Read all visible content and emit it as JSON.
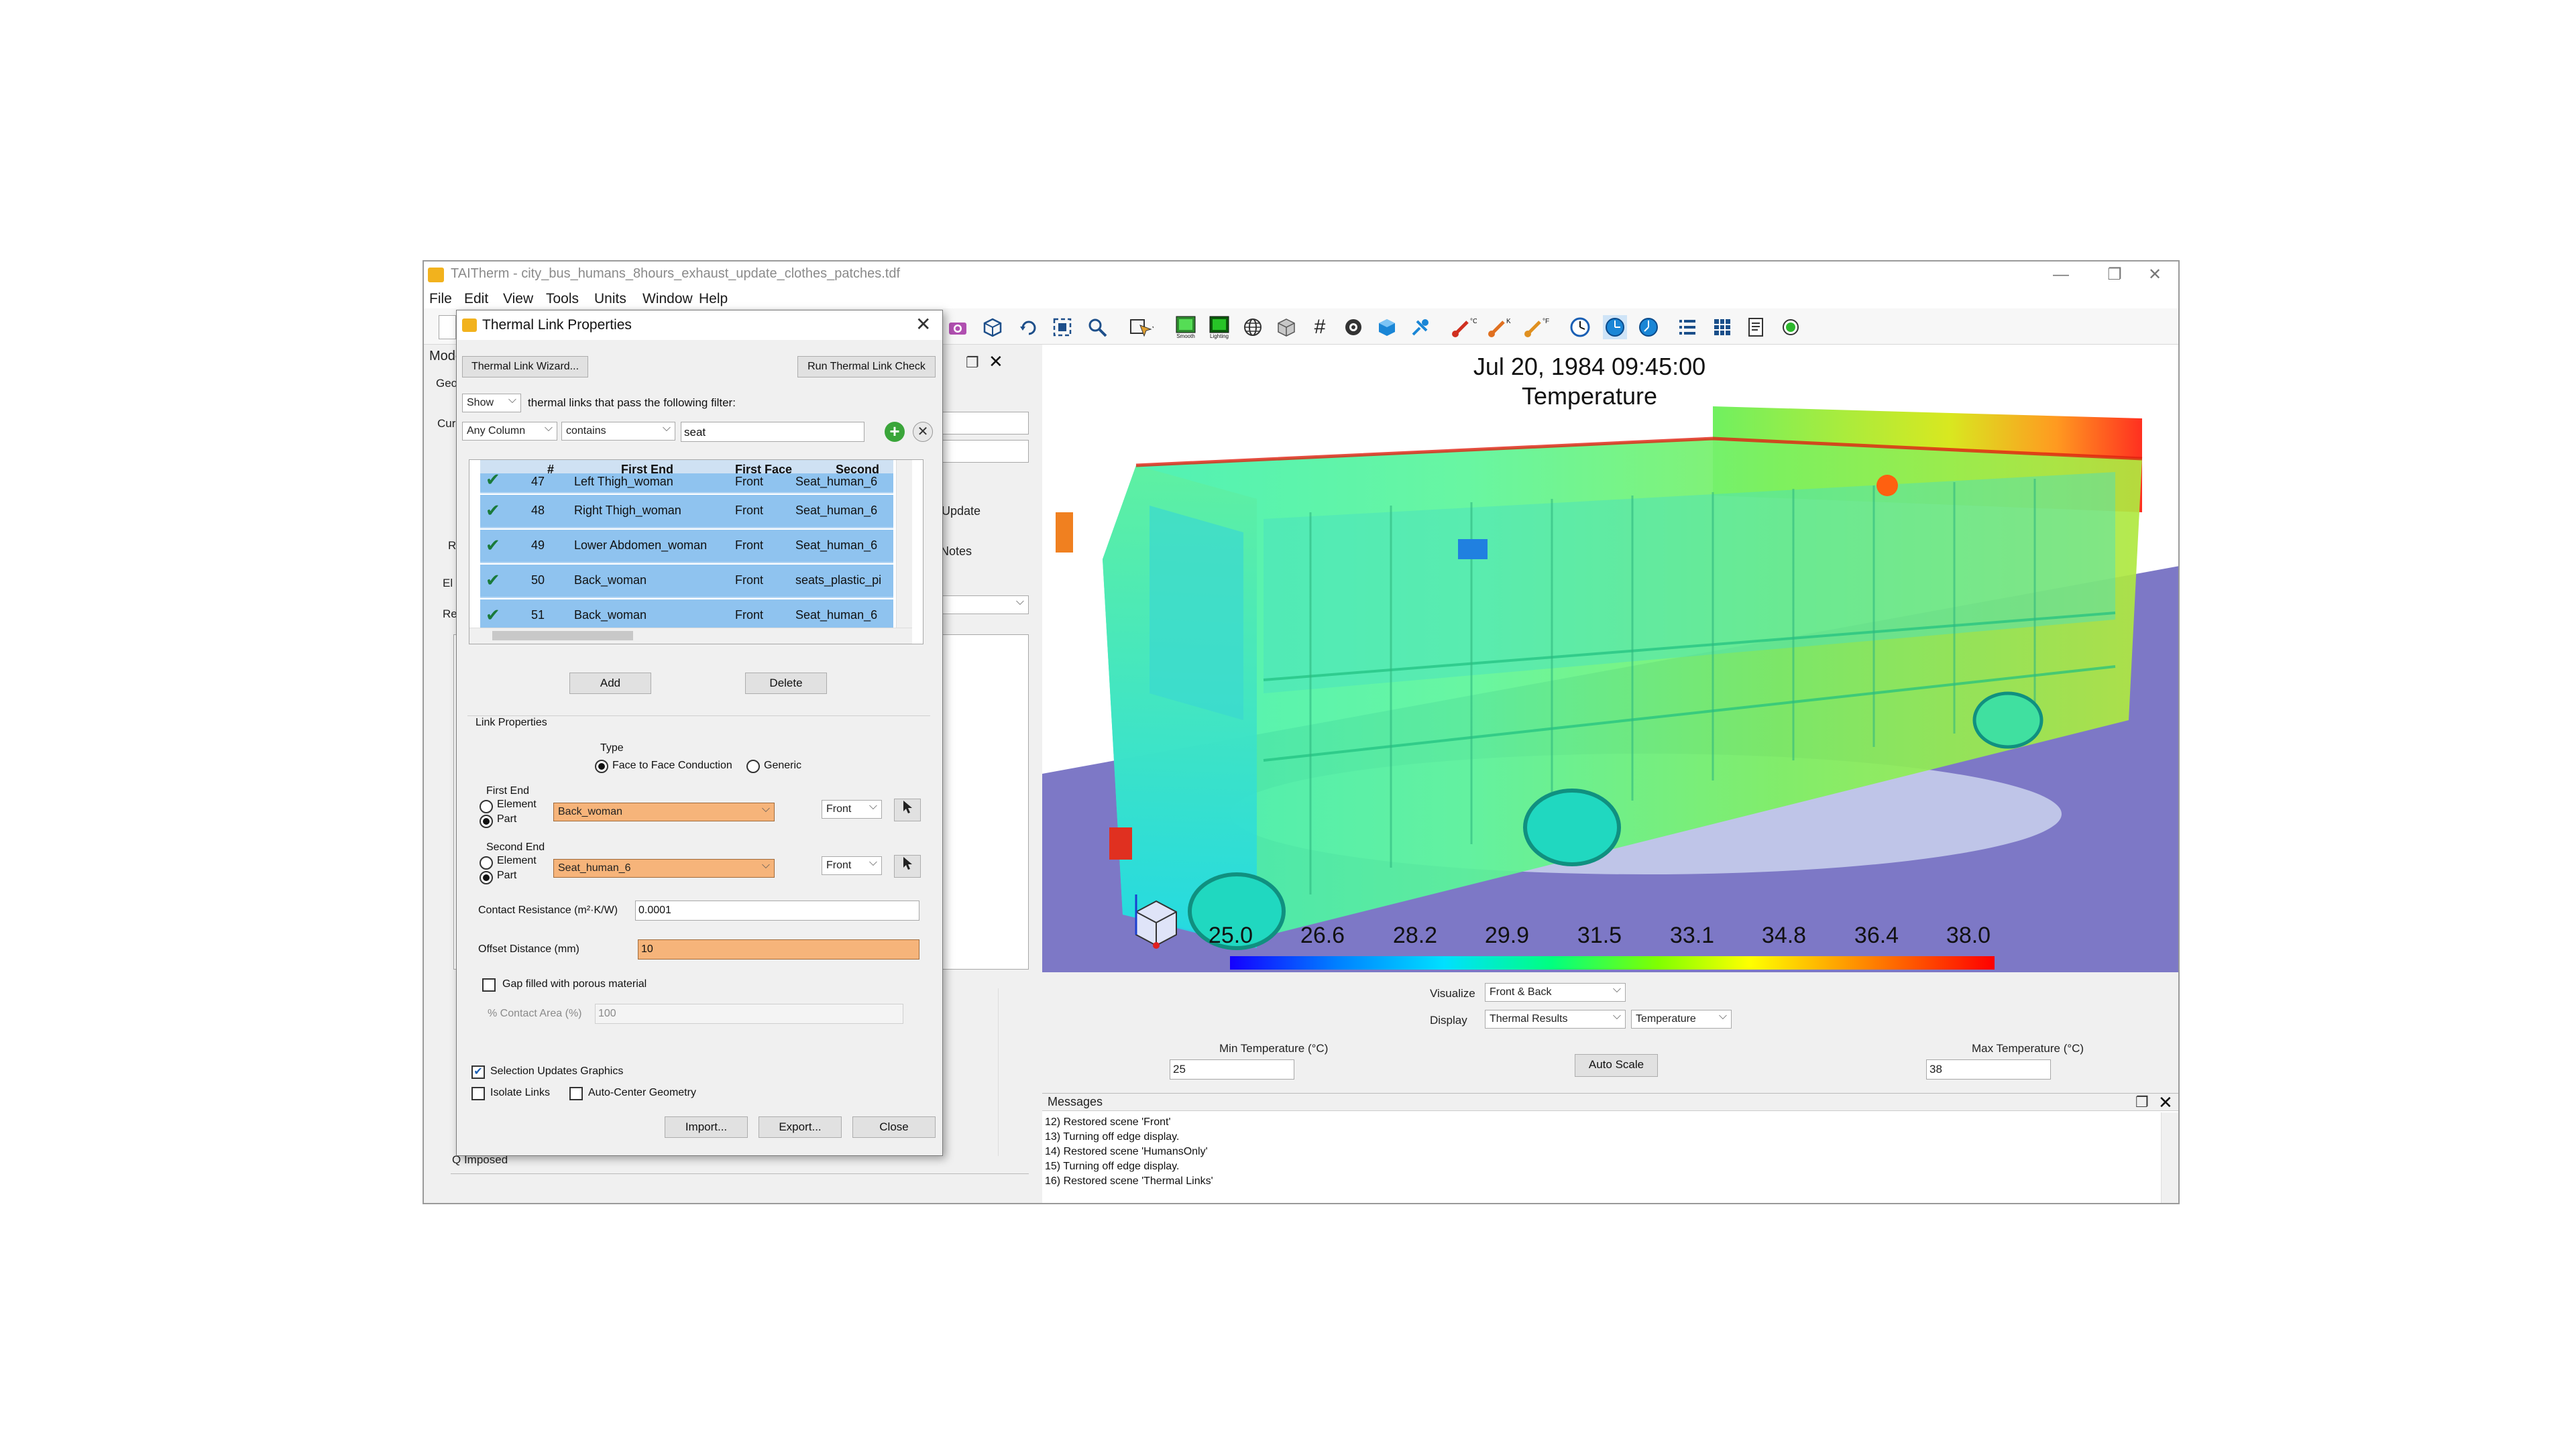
{
  "window": {
    "app_name": "TAITherm",
    "file_title": "city_bus_humans_8hours_exhaust_update_clothes_patches.tdf",
    "minimize": "—",
    "restore": "❐",
    "close": "✕"
  },
  "menu": [
    "File",
    "Edit",
    "View",
    "Tools",
    "Units",
    "Window",
    "Help"
  ],
  "toolbar": {
    "smooth_label": "Smooth",
    "lighting_label": "Lighting",
    "unit_c": "°C",
    "unit_k": "K",
    "unit_f": "°F",
    "icons": [
      "camera-icon",
      "view-cube-icon",
      "rotate-icon",
      "zoom-fit-icon",
      "zoom-box-icon",
      "select-icon",
      "smooth-icon",
      "lighting-icon",
      "globe-icon",
      "box-icon",
      "grid-icon",
      "sphere-icon",
      "solid-icon",
      "probe-icon",
      "thermometer-c-icon",
      "thermometer-k-icon",
      "thermometer-f-icon",
      "clock-icon",
      "clock-m-icon",
      "clock-h-icon",
      "list-icon",
      "table-icon",
      "report-icon",
      "record-icon"
    ]
  },
  "left_panel": {
    "label": "Mode",
    "geo_label": "Geo",
    "cur_label": "Cur",
    "update": "Update",
    "notes": "Notes",
    "re_label": "Re",
    "el_label": "El",
    "q_imposed": "Q Imposed"
  },
  "viewport": {
    "datetime": "Jul 20, 1984 09:45:00",
    "variable": "Temperature",
    "colorbar_labels": [
      "25.0",
      "26.6",
      "28.2",
      "29.9",
      "31.5",
      "33.1",
      "34.8",
      "36.4",
      "38.0"
    ],
    "colorbar_min": 25.0,
    "colorbar_max": 38.0,
    "colors": {
      "ground": "#7d78c6",
      "cold": "#1400ff",
      "mid": "#00ff80",
      "hot": "#ff0000"
    }
  },
  "visualize": {
    "visualize_label": "Visualize",
    "visualize_value": "Front & Back",
    "display_label": "Display",
    "display_value": "Thermal Results",
    "display_var": "Temperature",
    "min_label": "Min Temperature (°C)",
    "min_value": "25",
    "auto_scale": "Auto Scale",
    "max_label": "Max Temperature (°C)",
    "max_value": "38"
  },
  "messages": {
    "title": "Messages",
    "lines": [
      "12) Restored scene 'Front'",
      "13) Turning off edge display.",
      "14) Restored scene 'HumansOnly'",
      "15) Turning off edge display.",
      "16) Restored scene 'Thermal Links'"
    ]
  },
  "dialog": {
    "title": "Thermal Link Properties",
    "wizard_button": "Thermal Link Wizard...",
    "run_check_button": "Run Thermal Link Check",
    "show_select": "Show",
    "filter_text": "thermal links that pass the following filter:",
    "column_select": "Any Column",
    "op_select": "contains",
    "filter_value": "seat",
    "table": {
      "headers": [
        "#",
        "First End",
        "First Face",
        "Second En"
      ],
      "rows": [
        {
          "num": "47",
          "first_end": "Left Thigh_woman",
          "face": "Front",
          "second_end": "Seat_human_6"
        },
        {
          "num": "48",
          "first_end": "Right Thigh_woman",
          "face": "Front",
          "second_end": "Seat_human_6"
        },
        {
          "num": "49",
          "first_end": "Lower Abdomen_woman",
          "face": "Front",
          "second_end": "Seat_human_6"
        },
        {
          "num": "50",
          "first_end": "Back_woman",
          "face": "Front",
          "second_end": "seats_plastic_pi"
        },
        {
          "num": "51",
          "first_end": "Back_woman",
          "face": "Front",
          "second_end": "Seat_human_6"
        }
      ]
    },
    "add_button": "Add",
    "delete_button": "Delete",
    "link_properties": "Link Properties",
    "type_label": "Type",
    "type_option_1": "Face to Face Conduction",
    "type_option_2": "Generic",
    "first_end_label": "First End",
    "element_label": "Element",
    "part_label": "Part",
    "first_part_value": "Back_woman",
    "first_face_value": "Front",
    "second_end_label": "Second End",
    "second_part_value": "Seat_human_6",
    "second_face_value": "Front",
    "contact_resistance_label": "Contact Resistance (m²·K/W)",
    "contact_resistance_value": "0.0001",
    "offset_label": "Offset Distance (mm)",
    "offset_value": "10",
    "gap_label": "Gap filled with porous material",
    "contact_area_label": "% Contact Area (%)",
    "contact_area_value": "100",
    "selection_updates": "Selection Updates Graphics",
    "isolate_links": "Isolate Links",
    "auto_center": "Auto-Center Geometry",
    "import_button": "Import...",
    "export_button": "Export...",
    "close_button": "Close"
  }
}
